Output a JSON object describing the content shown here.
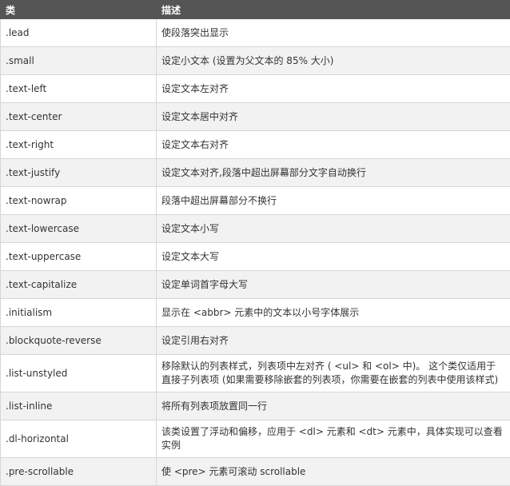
{
  "header": {
    "col1": "类",
    "col2": "描述"
  },
  "rows": [
    {
      "cls": ".lead",
      "desc": "使段落突出显示"
    },
    {
      "cls": ".small",
      "desc": "设定小文本 (设置为父文本的 85% 大小)"
    },
    {
      "cls": ".text-left",
      "desc": "设定文本左对齐"
    },
    {
      "cls": ".text-center",
      "desc": "设定文本居中对齐"
    },
    {
      "cls": ".text-right",
      "desc": "设定文本右对齐"
    },
    {
      "cls": ".text-justify",
      "desc": "设定文本对齐,段落中超出屏幕部分文字自动换行"
    },
    {
      "cls": ".text-nowrap",
      "desc": "段落中超出屏幕部分不换行"
    },
    {
      "cls": ".text-lowercase",
      "desc": "设定文本小写"
    },
    {
      "cls": ".text-uppercase",
      "desc": "设定文本大写"
    },
    {
      "cls": ".text-capitalize",
      "desc": "设定单词首字母大写"
    },
    {
      "cls": ".initialism",
      "desc": "显示在 <abbr> 元素中的文本以小号字体展示"
    },
    {
      "cls": ".blockquote-reverse",
      "desc": "设定引用右对齐"
    },
    {
      "cls": ".list-unstyled",
      "desc": "移除默认的列表样式，列表项中左对齐 ( <ul> 和 <ol> 中)。 这个类仅适用于直接子列表项 (如果需要移除嵌套的列表项，你需要在嵌套的列表中使用该样式)"
    },
    {
      "cls": ".list-inline",
      "desc": "将所有列表项放置同一行"
    },
    {
      "cls": ".dl-horizontal",
      "desc": "该类设置了浮动和偏移，应用于 <dl> 元素和 <dt> 元素中，具体实现可以查看实例"
    },
    {
      "cls": ".pre-scrollable",
      "desc": "使 <pre> 元素可滚动 scrollable"
    }
  ]
}
